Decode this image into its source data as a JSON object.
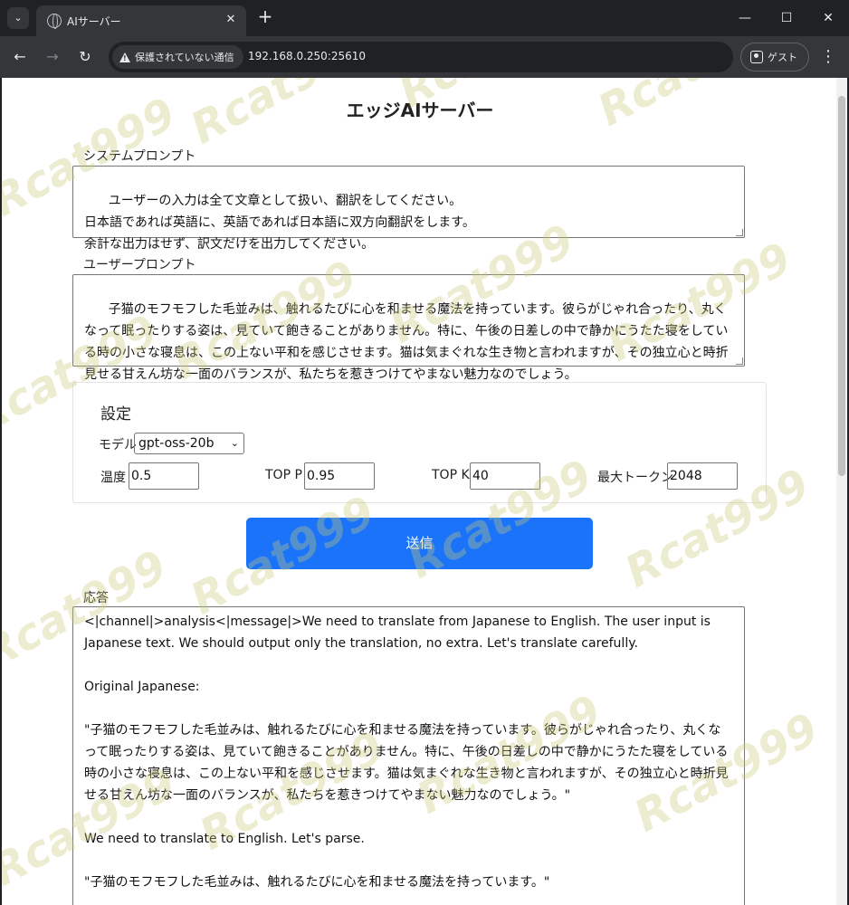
{
  "browser": {
    "tab_title": "AIサーバー",
    "tab_close": "✕",
    "new_tab": "+",
    "security_label": "保護されていない通信",
    "url": "192.168.0.250:25610",
    "profile_label": "ゲスト",
    "window_minimize": "—",
    "window_maximize": "☐",
    "window_close": "✕"
  },
  "page": {
    "title": "エッジAIサーバー",
    "system_prompt_label": "システムプロンプト",
    "system_prompt_value": "ユーザーの入力は全て文章として扱い、翻訳をしてください。\n日本語であれば英語に、英語であれば日本語に双方向翻訳をします。\n余計な出力はせず、訳文だけを出力してください。",
    "user_prompt_label": "ユーザープロンプト",
    "user_prompt_value": "子猫のモフモフした毛並みは、触れるたびに心を和ませる魔法を持っています。彼らがじゃれ合ったり、丸くなって眠ったりする姿は、見ていて飽きることがありません。特に、午後の日差しの中で静かにうたた寝をしている時の小さな寝息は、この上ない平和を感じさせます。猫は気まぐれな生き物と言われますが、その独立心と時折見せる甘えん坊な一面のバランスが、私たちを惹きつけてやまない魅力なのでしょう。",
    "settings": {
      "heading": "設定",
      "model_label": "モデル",
      "model_value": "gpt-oss-20b",
      "temperature_label": "温度",
      "temperature_value": "0.5",
      "top_p_label": "TOP P",
      "top_p_value": "0.95",
      "top_k_label": "TOP K",
      "top_k_value": "40",
      "max_tokens_label": "最大トークン",
      "max_tokens_value": "2048"
    },
    "send_label": "送信",
    "response_label": "応答",
    "response_value": "<|channel|>analysis<|message|>We need to translate from Japanese to English. The user input is Japanese text. We should output only the translation, no extra. Let's translate carefully.\n\nOriginal Japanese:\n\n\"子猫のモフモフした毛並みは、触れるたびに心を和ませる魔法を持っています。彼らがじゃれ合ったり、丸くなって眠ったりする姿は、見ていて飽きることがありません。特に、午後の日差しの中で静かにうたた寝をしている時の小さな寝息は、この上ない平和を感じさせます。猫は気まぐれな生き物と言われますが、その独立心と時折見せる甘えん坊な一面のバランスが、私たちを惹きつけてやまない魅力なのでしょう。\"\n\nWe need to translate to English. Let's parse.\n\n\"子猫のモフモフした毛並みは、触れるたびに心を和ませる魔法を持っています。\""
  },
  "watermark_text": "Rcat999"
}
